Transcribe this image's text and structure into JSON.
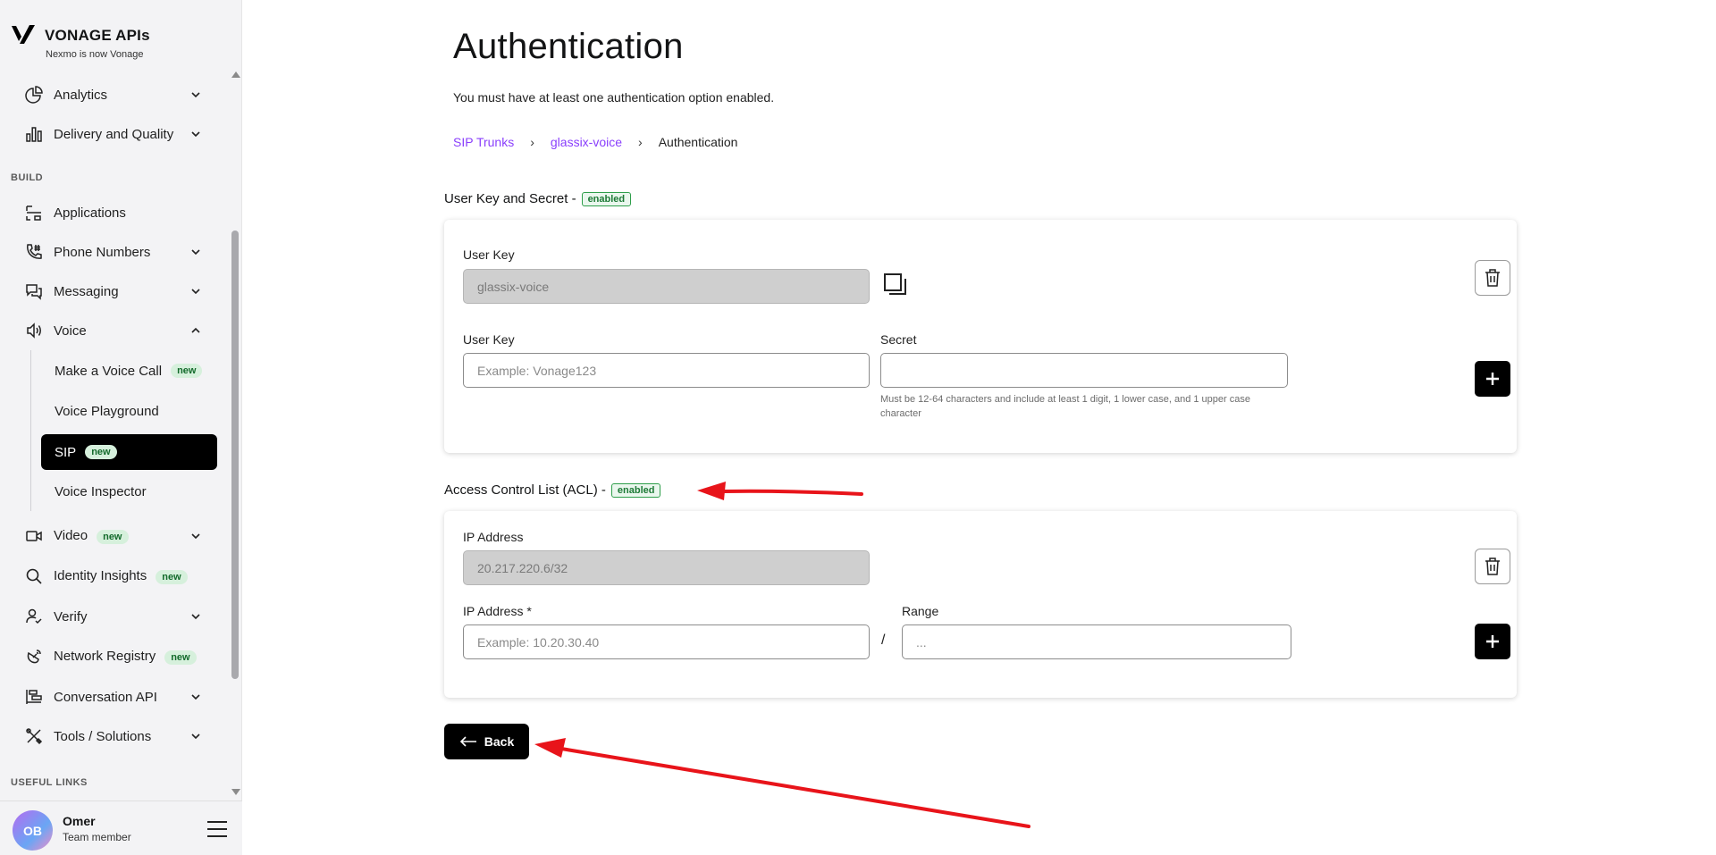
{
  "brand": {
    "title": "VONAGE APIs",
    "subtitle": "Nexmo is now Vonage"
  },
  "sidebar": {
    "items": [
      {
        "label": "Analytics"
      },
      {
        "label": "Delivery and Quality"
      },
      {
        "label": "Applications"
      },
      {
        "label": "Phone Numbers"
      },
      {
        "label": "Messaging"
      },
      {
        "label": "Voice"
      },
      {
        "label": "Video",
        "badge": "new"
      },
      {
        "label": "Identity Insights",
        "badge": "new"
      },
      {
        "label": "Verify"
      },
      {
        "label": "Network Registry",
        "badge": "new"
      },
      {
        "label": "Conversation API"
      },
      {
        "label": "Tools / Solutions"
      }
    ],
    "sections": {
      "build": "BUILD",
      "useful_links": "USEFUL LINKS"
    },
    "voice_sub": [
      {
        "label": "Make a Voice Call",
        "badge": "new"
      },
      {
        "label": "Voice Playground"
      },
      {
        "label": "SIP",
        "badge": "new"
      },
      {
        "label": "Voice Inspector"
      }
    ]
  },
  "user": {
    "initials": "OB",
    "name": "Omer",
    "role": "Team member"
  },
  "main": {
    "title": "Authentication",
    "description": "You must have at least one authentication option enabled.",
    "breadcrumb": {
      "sip_trunks": "SIP Trunks",
      "trunk": "glassix-voice",
      "current": "Authentication",
      "sep": "›"
    },
    "user_key_section": {
      "title": "User Key and Secret -",
      "status": "enabled",
      "existing_label": "User Key",
      "existing_value": "glassix-voice",
      "new_key_label": "User Key",
      "new_key_placeholder": "Example: Vonage123",
      "secret_label": "Secret",
      "secret_value": "",
      "secret_hint": "Must be 12-64 characters and include at least 1 digit, 1 lower case, and 1 upper case character"
    },
    "acl_section": {
      "title": "Access Control List (ACL) -",
      "status": "enabled",
      "existing_label": "IP Address",
      "existing_value": "20.217.220.6/32",
      "new_ip_label": "IP Address *",
      "new_ip_placeholder": "Example: 10.20.30.40",
      "range_label": "Range",
      "range_placeholder": "...",
      "slash": "/"
    },
    "back_label": "Back"
  },
  "colors": {
    "accent": "#8a3ffc",
    "enabled_green": "#2e9e4a",
    "annotation_red": "#e8141a"
  }
}
